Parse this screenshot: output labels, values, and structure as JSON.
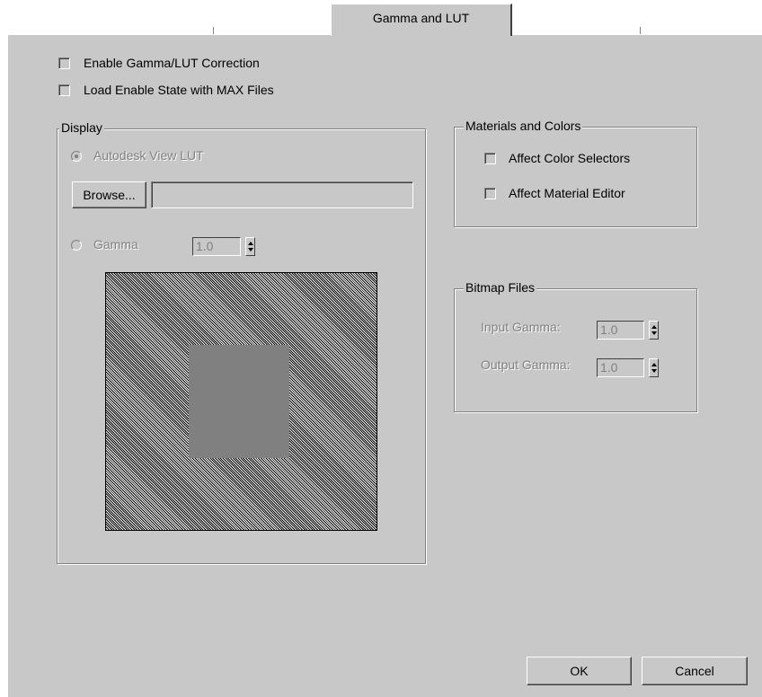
{
  "tab": {
    "label": "Gamma and LUT"
  },
  "options": {
    "enable_correction": {
      "label": "Enable Gamma/LUT Correction",
      "checked": false
    },
    "load_enable_state": {
      "label": "Load Enable State with MAX Files",
      "checked": false
    }
  },
  "display": {
    "title": "Display",
    "lut_radio": {
      "label": "Autodesk View LUT",
      "selected": true
    },
    "browse_label": "Browse...",
    "lut_path": "",
    "gamma_radio": {
      "label": "Gamma",
      "selected": false
    },
    "gamma_value": "1.0"
  },
  "materials": {
    "title": "Materials and Colors",
    "affect_color_selectors": {
      "label": "Affect Color Selectors",
      "checked": false
    },
    "affect_material_editor": {
      "label": "Affect Material Editor",
      "checked": false
    }
  },
  "bitmap": {
    "title": "Bitmap Files",
    "input_gamma_label": "Input Gamma:",
    "input_gamma_value": "1.0",
    "output_gamma_label": "Output Gamma:",
    "output_gamma_value": "1.0"
  },
  "footer": {
    "ok_label": "OK",
    "cancel_label": "Cancel"
  },
  "colors": {
    "panel": "#c8c8c8",
    "disabled_text": "#808080",
    "shadow": "#808080",
    "highlight": "#ffffff"
  }
}
